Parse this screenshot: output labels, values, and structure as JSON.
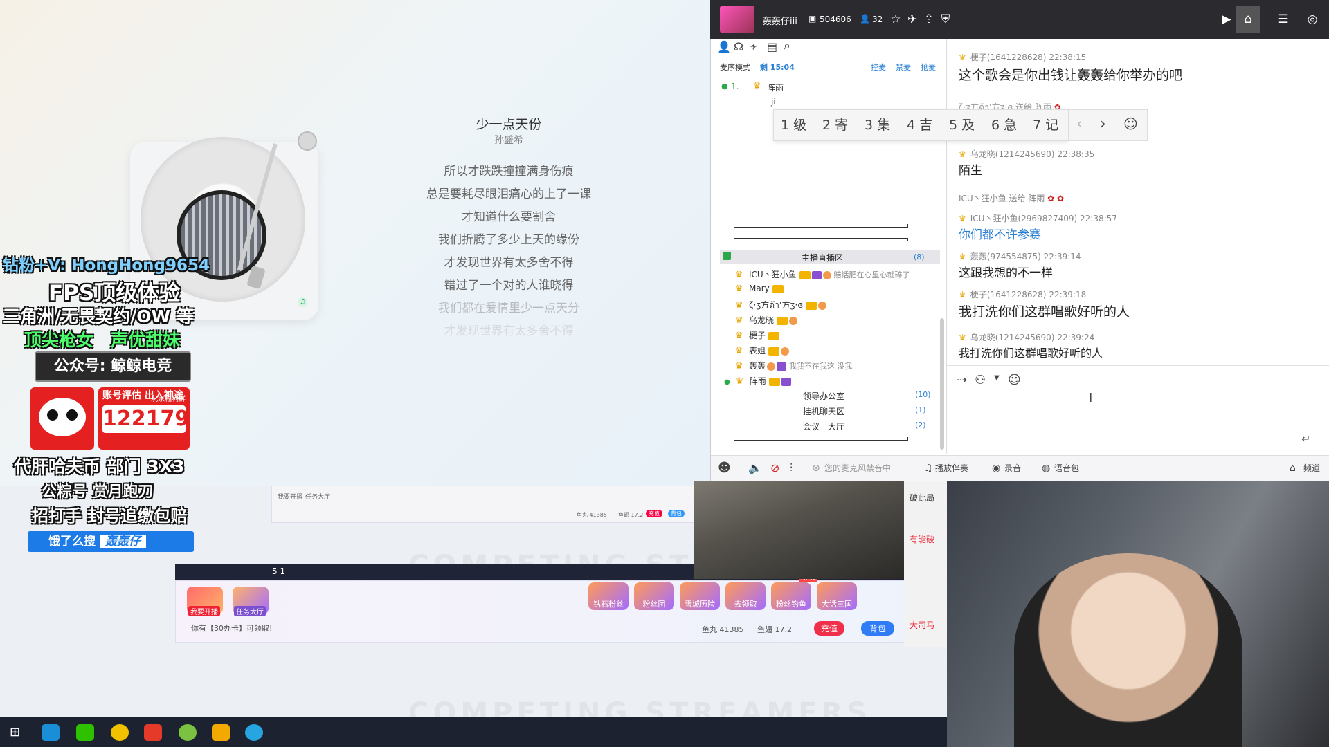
{
  "music": {
    "title": "少一点天份",
    "artist": "孙盛希",
    "lyrics": [
      "所以才跌跌撞撞满身伤痕",
      "总是要耗尽眼泪痛心的上了一课",
      "才知道什么要割舍",
      "我们折腾了多少上天的缘份",
      "才发现世界有太多舍不得",
      "错过了一个对的人谁晓得",
      "我们都在爱情里少一点天分",
      "才发现世界有太多舍不得"
    ]
  },
  "overlay": {
    "line1": "钻粉+V: HongHong9654",
    "line2": "FPS顶级体验",
    "line3": "三角洲/无畏契约/OW 等",
    "line4": "顶尖枪女　声优甜妹",
    "line5": "公众号: 鲸鲸电竞",
    "eval_label": "账号评估 出入神途",
    "eval_sub": "玩家福利群",
    "eval_number": "122179",
    "line6": "代肝哈夫币 部门 3X3",
    "line7": "公粽号 赏月跑刀",
    "line8": "招打手 封号追缴包赔",
    "search_prefix": "饿了么搜",
    "search_keyword": "轰轰仔"
  },
  "embedded": {
    "tab_text": "5 1",
    "gifts": [
      "钻石粉丝",
      "粉丝团",
      "雪城历险",
      "去领取",
      "粉丝钓鱼",
      "大话三国"
    ],
    "left_buttons": [
      "我要开播",
      "任务大厅"
    ],
    "new_badge": "NEW",
    "card_text": "你有【30办卡】可领取!",
    "fish_balls": "鱼丸 41385",
    "fish_wings": "鱼翅 17.2",
    "recharge": "充值",
    "backpack": "背包",
    "small_fish": "鱼丸 41385",
    "small_wings": "鱼翅 17.2",
    "small_recharge": "充值",
    "small_pack": "背包",
    "small_gifts": [
      "钻石粉丝",
      "粉丝团",
      "雪城历险",
      "去领取",
      "粉丝钓鱼",
      "大话三国"
    ],
    "small_left": [
      "我要开播",
      "任务大厅"
    ]
  },
  "watermark": "COMPETING STREAMERS",
  "topbar": {
    "room_name": "轰轰仔iii",
    "room_id": "504606",
    "online": "32"
  },
  "channel": {
    "mode": "麦序模式",
    "remain": "剩 15:04",
    "actions": [
      "控麦",
      "禁麦",
      "抢麦"
    ],
    "queue": [
      {
        "index": "1.",
        "name": "阵雨"
      }
    ],
    "queue_sub": "ji",
    "main_room": "主播直播区",
    "main_count": "(8)",
    "members": [
      {
        "name": "ICU丶狂小鱼",
        "note": "赔话肥在心里心就碎了"
      },
      {
        "name": "Mary",
        "note": ""
      },
      {
        "name": "ζ·ʒ方ด้าʼ方ʒ·ɞ",
        "note": ""
      },
      {
        "name": "乌龙晓",
        "note": ""
      },
      {
        "name": "梗子",
        "note": ""
      },
      {
        "name": "表姐",
        "note": ""
      },
      {
        "name": "轰轰",
        "note": "我我不在我这 没我"
      },
      {
        "name": "阵雨",
        "note": ""
      }
    ],
    "subrooms": [
      {
        "name": "领导办公室",
        "count": "(10)"
      },
      {
        "name": "挂机聊天区",
        "count": "(1)"
      },
      {
        "name": "会议　大厅",
        "count": "(2)"
      }
    ]
  },
  "ime": {
    "candidates": [
      "1 级",
      "2 寄",
      "3 集",
      "4 吉",
      "5 及",
      "6 急",
      "7 记"
    ],
    "prev": "‹",
    "next": "›",
    "emoji": "☺"
  },
  "chat": [
    {
      "user": "梗子(1641228628)",
      "time": "22:38:15",
      "text": "这个歌会是你出钱让轰轰给你举办的吧",
      "big": true
    },
    {
      "user": "ζ·ʒ方ด้าʼ方ʒ·ɞ 送给 阵雨",
      "time": "",
      "text": "",
      "gift": true
    },
    {
      "user": "乌龙晓(1214245690)",
      "time": "22:38:35",
      "text": "陌生",
      "big": false
    },
    {
      "user": "ICU丶狂小鱼 送给 阵雨",
      "time": "",
      "text": "",
      "gift": true
    },
    {
      "user": "ICU丶狂小鱼(2969827409)",
      "time": "22:38:57",
      "text": "你们都不许参赛",
      "big": false,
      "blue": true
    },
    {
      "user": "轰轰(974554875)",
      "time": "22:39:14",
      "text": "这跟我想的不一样",
      "big": false
    },
    {
      "user": "梗子(1641228628)",
      "time": "22:39:18",
      "text": "我打洗你们这群唱歌好听的人",
      "big": true
    },
    {
      "user": "乌龙晓(1214245690)",
      "time": "22:39:24",
      "text": "我打洗你们这群唱歌好听的人",
      "big": false
    }
  ],
  "voicebar": {
    "mic_notice": "您的麦克风禁音中",
    "play_accomp": "播放伴奏",
    "record": "录音",
    "voice_pack": "语音包",
    "channel": "频道"
  },
  "side_cam": {
    "t1": "破此局",
    "t2": "有能破",
    "t3": "大司马"
  }
}
